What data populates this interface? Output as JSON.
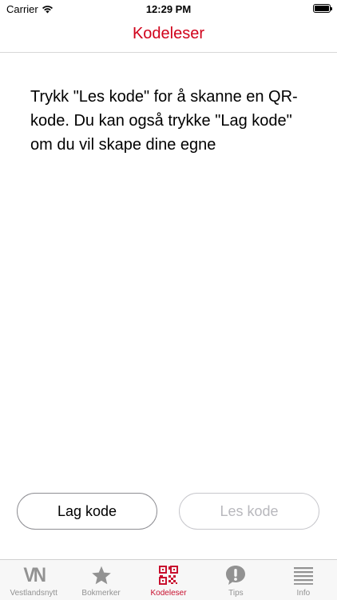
{
  "status_bar": {
    "carrier": "Carrier",
    "time": "12:29 PM"
  },
  "nav": {
    "title": "Kodeleser"
  },
  "main": {
    "instructions": "Trykk \"Les kode\" for å skanne en QR-kode. Du kan også trykke \"Lag kode\" om du vil skape dine egne"
  },
  "buttons": {
    "create_label": "Lag kode",
    "read_label": "Les kode"
  },
  "tab_bar": {
    "items": [
      {
        "label": "Vestlandsnytt",
        "logo_text": "VN",
        "icon": "vn-logo-icon"
      },
      {
        "label": "Bokmerker",
        "icon": "star-icon"
      },
      {
        "label": "Kodeleser",
        "icon": "qr-code-icon",
        "active": true
      },
      {
        "label": "Tips",
        "icon": "exclamation-bubble-icon"
      },
      {
        "label": "Info",
        "icon": "list-icon"
      }
    ]
  },
  "colors": {
    "accent": "#d0021b",
    "tab_inactive": "#929292",
    "button_disabled_text": "#b8b8bd"
  }
}
